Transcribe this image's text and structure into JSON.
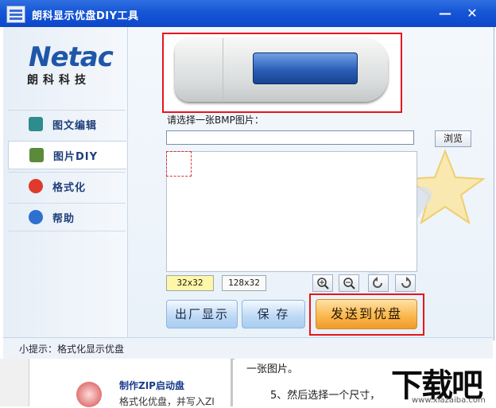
{
  "window": {
    "title": "朗科显示优盘DIY工具",
    "minimize": "—",
    "close": "✕"
  },
  "brand": {
    "logo": "Netac",
    "subtitle": "朗科科技"
  },
  "sidebar": {
    "items": [
      {
        "label": "图文编辑",
        "icon": "text-edit-icon"
      },
      {
        "label": "图片DIY",
        "icon": "image-diy-icon"
      },
      {
        "label": "格式化",
        "icon": "format-icon"
      },
      {
        "label": "帮助",
        "icon": "help-icon"
      }
    ]
  },
  "main": {
    "prompt": "请选择一张BMP图片：",
    "path_value": "",
    "browse_label": "浏览",
    "size_options": [
      "32x32",
      "128x32"
    ],
    "tools": [
      "zoom-in-icon",
      "zoom-out-icon",
      "rotate-left-icon",
      "rotate-right-icon"
    ]
  },
  "actions": {
    "factory_display": "出厂显示",
    "save": "保 存",
    "send": "发送到优盘"
  },
  "status": {
    "hint": "小提示：格式化显示优盘"
  },
  "background_page": {
    "item_title": "制作ZIP启动盘",
    "item_desc": "格式化优盘，并写入ZI",
    "line1": "一张图片。",
    "line2": "5、然后选择一个尺寸，",
    "watermark": "下载吧",
    "watermark_url": "www.xiazaiba.com"
  },
  "colors": {
    "titlebar": "#1656d6",
    "highlight": "#e8141c",
    "send_button": "#f9b54a"
  }
}
